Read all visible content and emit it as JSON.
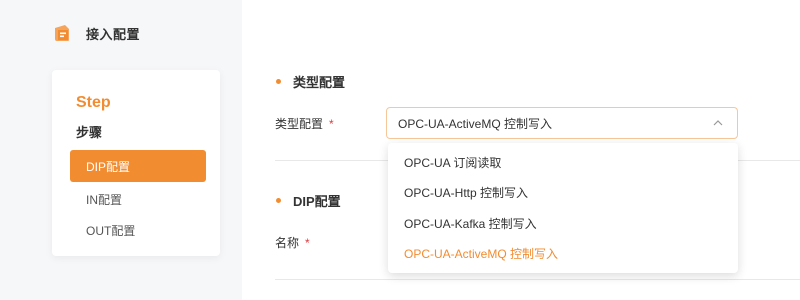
{
  "app": {
    "title": "接入配置",
    "logo_icon": "config-logo-icon"
  },
  "steps": {
    "heading": "Step",
    "subheading": "步骤",
    "items": [
      {
        "label": "DIP配置",
        "active": true
      },
      {
        "label": "IN配置",
        "active": false
      },
      {
        "label": "OUT配置",
        "active": false
      }
    ]
  },
  "sections": {
    "type": {
      "title": "类型配置",
      "field_label": "类型配置",
      "required_mark": "*",
      "selected_value": "OPC-UA-ActiveMQ 控制写入"
    },
    "dip": {
      "title": "DIP配置",
      "field_label": "名称",
      "required_mark": "*"
    }
  },
  "dropdown": {
    "options": [
      {
        "label": "OPC-UA 订阅读取",
        "selected": false
      },
      {
        "label": "OPC-UA-Http 控制写入",
        "selected": false
      },
      {
        "label": "OPC-UA-Kafka 控制写入",
        "selected": false
      },
      {
        "label": "OPC-UA-ActiveMQ 控制写入",
        "selected": true
      }
    ]
  },
  "colors": {
    "accent": "#f28c31",
    "required": "#e4393c"
  }
}
